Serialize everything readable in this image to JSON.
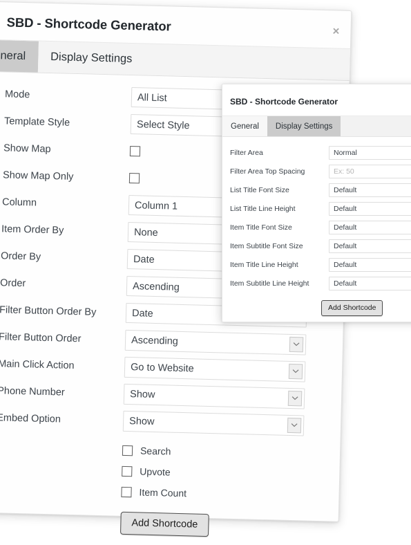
{
  "main_dialog": {
    "title": "SBD - Shortcode Generator",
    "close_label": "×",
    "tabs": [
      {
        "label": "General",
        "active": true
      },
      {
        "label": "Display Settings",
        "active": false
      }
    ],
    "fields": [
      {
        "label": "Mode",
        "type": "text",
        "value": "All List"
      },
      {
        "label": "Template Style",
        "type": "text",
        "value": "Select Style"
      },
      {
        "label": "Show Map",
        "type": "checkbox",
        "checked": false
      },
      {
        "label": "Show Map Only",
        "type": "checkbox",
        "checked": false
      },
      {
        "label": "Column",
        "type": "text",
        "value": "Column 1"
      },
      {
        "label": "Item Order By",
        "type": "text",
        "value": "None"
      },
      {
        "label": "Order By",
        "type": "text",
        "value": "Date"
      },
      {
        "label": "Order",
        "type": "text",
        "value": "Ascending"
      },
      {
        "label": "Filter Button Order By",
        "type": "text",
        "value": "Date"
      },
      {
        "label": "Filter Button Order",
        "type": "select",
        "value": "Ascending"
      },
      {
        "label": "Main Click Action",
        "type": "select",
        "value": "Go to Website"
      },
      {
        "label": "Phone Number",
        "type": "select",
        "value": "Show"
      },
      {
        "label": "Embed Option",
        "type": "select",
        "value": "Show"
      }
    ],
    "checkboxes": [
      {
        "label": "Search",
        "checked": false
      },
      {
        "label": "Upvote",
        "checked": false
      },
      {
        "label": "Item Count",
        "checked": false
      }
    ],
    "submit_label": "Add Shortcode"
  },
  "second_dialog": {
    "title": "SBD - Shortcode Generator",
    "tabs": [
      {
        "label": "General",
        "active": false
      },
      {
        "label": "Display Settings",
        "active": true
      }
    ],
    "fields": [
      {
        "label": "Filter Area",
        "value": "Normal",
        "placeholder": false
      },
      {
        "label": "Filter Area Top Spacing",
        "value": "Ex: 50",
        "placeholder": true
      },
      {
        "label": "List Title Font Size",
        "value": "Default",
        "placeholder": false
      },
      {
        "label": "List Title Line Height",
        "value": "Default",
        "placeholder": false
      },
      {
        "label": "Item Title Font Size",
        "value": "Default",
        "placeholder": false
      },
      {
        "label": "Item Subtitle Font Size",
        "value": "Default",
        "placeholder": false
      },
      {
        "label": "Item Title Line Height",
        "value": "Default",
        "placeholder": false
      },
      {
        "label": "Item Subtitle Line Height",
        "value": "Default",
        "placeholder": false
      }
    ],
    "submit_label": "Add Shortcode"
  },
  "colors": {
    "page_background": "#ffffff",
    "dialog_background": "#ffffff",
    "tab_active": "#cbcbcb",
    "tab_inactive": "#f4f4f4",
    "text": "#3c434a",
    "title_text": "#23282d",
    "border": "#dcdcdc",
    "button_face": "#e2e2e2",
    "placeholder_text": "#b6b6b6",
    "close_icon": "#a8a8a8"
  }
}
